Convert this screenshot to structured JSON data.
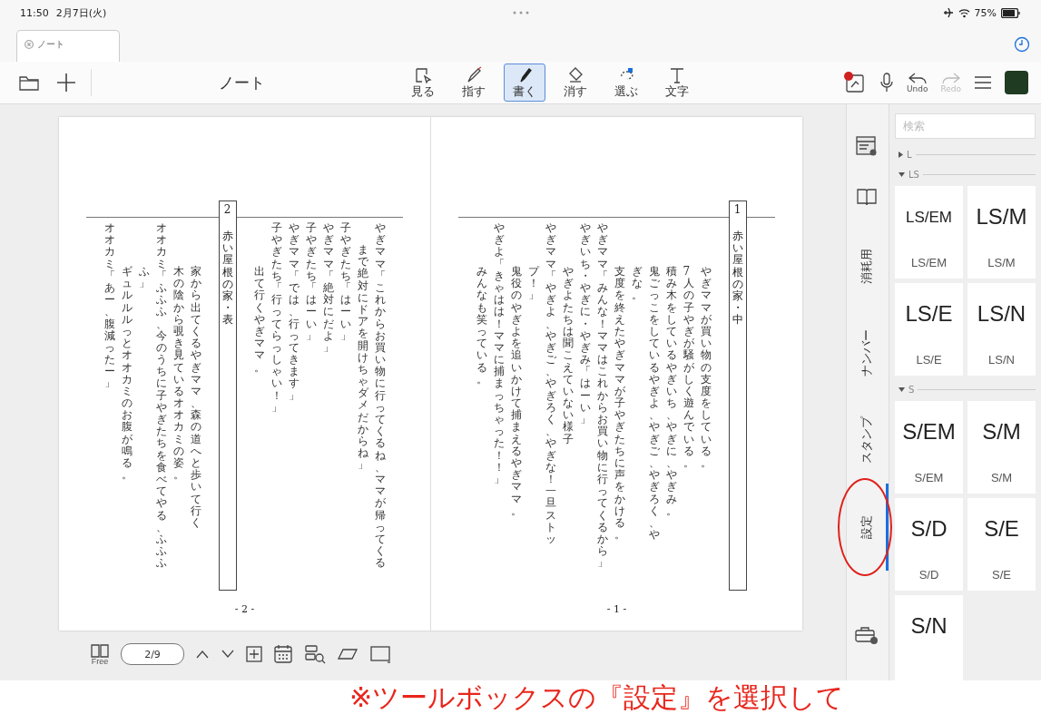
{
  "status_bar": {
    "time": "11:50",
    "date": "2月7日(火)",
    "battery": "75%"
  },
  "document_tab": {
    "label": "ノート"
  },
  "toolbar": {
    "title": "ノート",
    "tools": [
      {
        "label": "見る",
        "kind": "view",
        "selected": false
      },
      {
        "label": "指す",
        "kind": "point",
        "selected": false
      },
      {
        "label": "書く",
        "kind": "pen",
        "selected": true
      },
      {
        "label": "消す",
        "kind": "eraser",
        "selected": false
      },
      {
        "label": "選ぶ",
        "kind": "lasso",
        "selected": false
      },
      {
        "label": "文字",
        "kind": "text",
        "selected": false
      }
    ],
    "undo": {
      "label": "Undo",
      "disabled": false
    },
    "redo": {
      "label": "Redo",
      "disabled": true
    }
  },
  "pages": [
    {
      "footer": "- 2 -",
      "columns": [
        {
          "kind": "line",
          "text": "オオカミ「あー、腹減ったー」"
        },
        {
          "kind": "direction",
          "text": "ギュルルルっとオオカミのお腹が鳴る。"
        },
        {
          "kind": "wrap",
          "text": "ふ」"
        },
        {
          "kind": "line",
          "text": "オオカミ「ふふふ、今のうちに子やぎたちを食べてやる、ふふふ"
        },
        {
          "kind": "direction",
          "text": "木の陰から覗き見ているオオカミの姿。"
        },
        {
          "kind": "direction",
          "text": "家から出てくるやぎママ、森の道へと歩いて行く"
        },
        {
          "kind": "scene",
          "number": "2",
          "text": "赤い屋根の家・表"
        },
        {
          "kind": "direction",
          "text": "出て行くやぎママ。"
        },
        {
          "kind": "line",
          "text": "子やぎたち「行ってらっしゃい！」"
        },
        {
          "kind": "line",
          "text": "やぎママ「では、行ってきます」"
        },
        {
          "kind": "line",
          "text": "子やぎたち「はーい」"
        },
        {
          "kind": "line",
          "text": "やぎママ「絶対にだよ」"
        },
        {
          "kind": "line",
          "text": "子やぎたち「はーい」"
        },
        {
          "kind": "continuation",
          "text": "まで絶対にドアを開けちゃダメだからね」"
        },
        {
          "kind": "line",
          "text": "やぎママ「これからお買い物に行ってくるね、ママが帰ってくる"
        }
      ]
    },
    {
      "footer": "- 1 -",
      "columns": [
        {
          "kind": "direction",
          "text": "みんなも笑っている。"
        },
        {
          "kind": "line",
          "text": "やぎよ「きゃはは！ママに捕まっちゃった！！」"
        },
        {
          "kind": "direction",
          "text": "鬼役のやぎよを追いかけて捕まえるやぎママ。"
        },
        {
          "kind": "wrap",
          "text": "プ！」"
        },
        {
          "kind": "line",
          "text": "やぎママ「やぎよ、やぎご、やぎろく、やぎな！一旦ストッ"
        },
        {
          "kind": "direction",
          "text": "やぎよたちは聞こえていない様子"
        },
        {
          "kind": "line",
          "text": "やぎいち・やぎに・やぎみ「はーい」"
        },
        {
          "kind": "line",
          "text": "やぎママ「みんな！ママはこれからお買い物に行ってくるから」"
        },
        {
          "kind": "direction",
          "text": "支度を終えたやぎママが子やぎたちに声をかける。"
        },
        {
          "kind": "direction",
          "text": "ぎな。"
        },
        {
          "kind": "direction",
          "text": "鬼ごっこをしているやぎよ、やぎご、やぎろく、や"
        },
        {
          "kind": "direction",
          "text": "積み木をしているやぎいち、やぎに、やぎみ。"
        },
        {
          "kind": "direction",
          "text": "7人の子やぎが騒がしく遊んでいる。"
        },
        {
          "kind": "direction",
          "text": "やぎママが買い物の支度をしている。"
        },
        {
          "kind": "scene",
          "number": "1",
          "text": "赤い屋根の家・中"
        }
      ]
    }
  ],
  "bottom_toolbar": {
    "book_label": "Free",
    "page": "2/9"
  },
  "toolbox_tabs": [
    {
      "kind": "templates",
      "selected": false,
      "circled": false
    },
    {
      "kind": "book",
      "selected": false,
      "circled": false
    },
    {
      "kind": "text",
      "label": "消耗用",
      "selected": false,
      "circled": false
    },
    {
      "kind": "text",
      "label": "ナンバー",
      "selected": false,
      "circled": false
    },
    {
      "kind": "text",
      "label": "スタンプ",
      "selected": false,
      "circled": false
    },
    {
      "kind": "text",
      "label": "設定",
      "selected": true,
      "circled": true
    },
    {
      "kind": "toolbox",
      "selected": false,
      "circled": false
    }
  ],
  "panel": {
    "search": {
      "placeholder": "検索"
    },
    "sections": [
      {
        "label": "L",
        "expanded": false
      },
      {
        "label": "LS",
        "expanded": true,
        "items": [
          {
            "symbol": "LS/EM",
            "caption": "LS/EM"
          },
          {
            "symbol": "LS/M",
            "caption": "LS/M"
          },
          {
            "symbol": "LS/E",
            "caption": "LS/E"
          },
          {
            "symbol": "LS/N",
            "caption": "LS/N"
          }
        ]
      },
      {
        "label": "S",
        "expanded": true,
        "items": [
          {
            "symbol": "S/EM",
            "caption": "S/EM"
          },
          {
            "symbol": "S/M",
            "caption": "S/M"
          },
          {
            "symbol": "S/D",
            "caption": "S/D"
          },
          {
            "symbol": "S/E",
            "caption": "S/E"
          },
          {
            "symbol": "S/N"
          }
        ]
      }
    ]
  },
  "caption": "※ツールボックスの『設定』を選択して"
}
